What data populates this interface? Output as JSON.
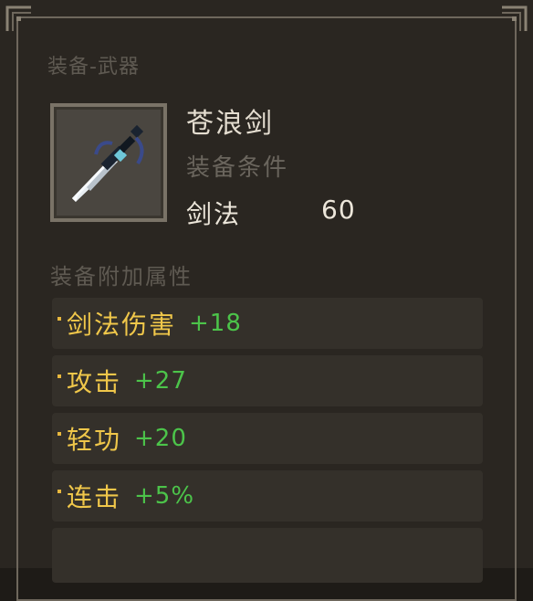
{
  "category": "装备-武器",
  "item": {
    "name": "苍浪剑",
    "icon": "sword-icon"
  },
  "requirement": {
    "label": "装备条件",
    "skill": "剑法",
    "value": "60"
  },
  "attributes_title": "装备附加属性",
  "attributes": [
    {
      "name": "剑法伤害",
      "value": "+18"
    },
    {
      "name": "攻击",
      "value": "+27"
    },
    {
      "name": "轻功",
      "value": "+20"
    },
    {
      "name": "连击",
      "value": "+5%"
    }
  ],
  "colors": {
    "attribute_name": "#f0c74a",
    "attribute_value": "#4cc44a"
  }
}
